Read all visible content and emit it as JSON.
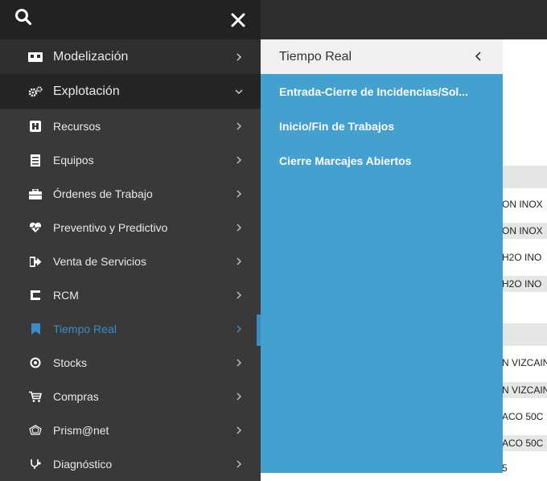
{
  "header": {
    "search_icon": "search-icon",
    "close_icon": "close-icon"
  },
  "sidebar": {
    "top_items": [
      {
        "label": "Modelización",
        "icon": "model-icon",
        "chevron": "chevron-right-icon"
      },
      {
        "label": "Explotación",
        "icon": "cogs-icon",
        "chevron": "chevron-down-icon"
      }
    ],
    "items": [
      {
        "label": "Recursos",
        "icon": "resources-icon"
      },
      {
        "label": "Equipos",
        "icon": "equipment-icon"
      },
      {
        "label": "Órdenes de Trabajo",
        "icon": "briefcase-icon"
      },
      {
        "label": "Preventivo y Predictivo",
        "icon": "heartbeat-icon"
      },
      {
        "label": "Venta de Servicios",
        "icon": "sign-out-icon"
      },
      {
        "label": "RCM",
        "icon": "rcm-icon"
      },
      {
        "label": "Tiempo Real",
        "icon": "bookmark-icon",
        "active": true
      },
      {
        "label": "Stocks",
        "icon": "target-icon"
      },
      {
        "label": "Compras",
        "icon": "cart-icon"
      },
      {
        "label": "Prism@net",
        "icon": "gem-icon"
      },
      {
        "label": "Diagnóstico",
        "icon": "stethoscope-icon"
      }
    ],
    "active_color": "#3a8cc8"
  },
  "submenu": {
    "title": "Tiempo Real",
    "items": [
      "Entrada-Cierre de Incidencias/Sol...",
      "Inicio/Fin de Trabajos",
      "Cierre Marcajes Abiertos"
    ],
    "background": "#43a0cf"
  },
  "background_rows": [
    "ON INOX",
    "ON INOX",
    "H2O INO",
    "H2O INO",
    "N VIZCAIN",
    "N VIZCAIN",
    "ACO 50C",
    "ACO 50C",
    "5"
  ]
}
